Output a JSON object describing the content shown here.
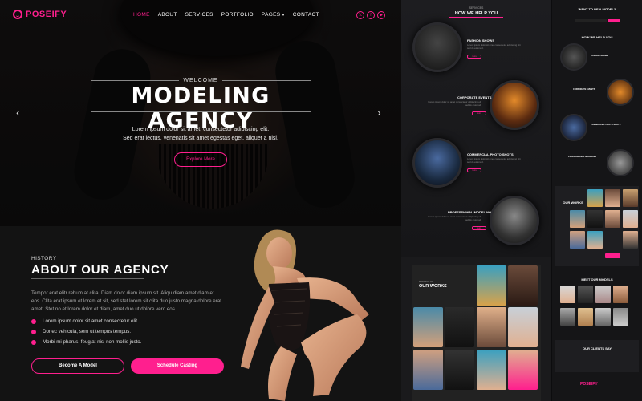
{
  "brand": {
    "name": "POSEIFY",
    "accent": "#ff1f8e"
  },
  "nav": {
    "items": [
      {
        "label": "HOME",
        "active": true
      },
      {
        "label": "ABOUT"
      },
      {
        "label": "SERVICES"
      },
      {
        "label": "PORTFOLIO"
      },
      {
        "label": "PAGES"
      },
      {
        "label": "CONTACT"
      }
    ],
    "socials": [
      "x-icon",
      "facebook-icon",
      "youtube-icon"
    ]
  },
  "hero": {
    "welcome": "WELCOME",
    "title": "MODELING AGENCY",
    "text_line1": "Lorem ipsum dolor sit amet, consectetur adipiscing elit.",
    "text_line2": "Sed erat lectus, venenatis sit amet egestas eget, aliquet a nisl.",
    "cta": "Explore More"
  },
  "about": {
    "eyebrow": "HISTORY",
    "title": "ABOUT OUR AGENCY",
    "paragraph": "Tempor erat elitr rebum at clita. Diam dolor diam ipsum sit. Aliqu diam amet diam et eos. Clita erat ipsum et lorem et sit, sed stet lorem sit clita duo justo magna dolore erat amet. Stet no et lorem dolor et diam, amet duo ut dolore vero eos.",
    "bullets": [
      "Lorem ipsum dolor sit amet consectetur elit.",
      "Donec vehicula, sem ut tempus tempus.",
      "Morbi mi pharus, feugiat nisi non mollis justo."
    ],
    "btn_outline": "Become A Model",
    "btn_fill": "Schedule Casting"
  },
  "services_page": {
    "eyebrow": "SERVICES",
    "title": "HOW WE HELP YOU",
    "items": [
      {
        "label": "FASHION SHOWS"
      },
      {
        "label": "CORPORATE EVENTS"
      },
      {
        "label": "COMMERCIAL PHOTO SHOTS"
      },
      {
        "label": "PROFESSIONAL MODELING"
      }
    ],
    "works_eyebrow": "PORTFOLIO",
    "works_title": "OUR WORKS"
  },
  "mobile_page": {
    "top_title": "WANT TO BE A MODEL?",
    "help_title": "HOW WE HELP YOU",
    "items": [
      "FASHION SHOWS",
      "CORPORATE EVENTS",
      "COMMERCIAL PHOTO SHOTS",
      "PROFESSIONAL MODELING"
    ],
    "works_title": "OUR WORKS",
    "models_title": "MEET OUR MODELS",
    "clients_title": "OUR CLIENTS SAY",
    "footer_logo": "POSEIFY"
  }
}
